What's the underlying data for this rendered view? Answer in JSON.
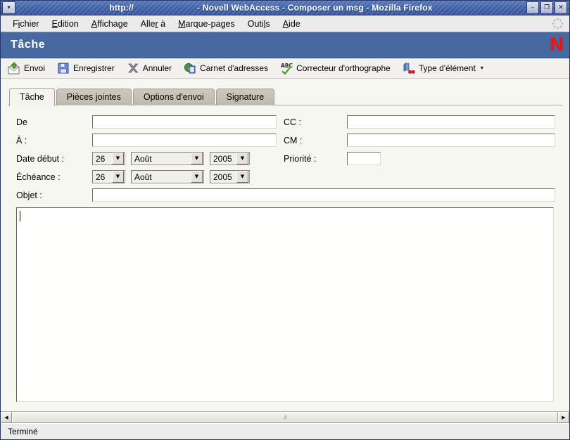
{
  "titlebar": {
    "url": "http://",
    "title": "- Novell WebAccess - Composer un msg - Mozilla Firefox",
    "sysmenu_icon": "chevron-down-icon",
    "minimize_label": "–",
    "maximize_label": "❐",
    "close_label": "✕"
  },
  "menubar": {
    "items": [
      {
        "pre": "F",
        "accel": "i",
        "post": "chier"
      },
      {
        "pre": "",
        "accel": "E",
        "post": "dition"
      },
      {
        "pre": "",
        "accel": "A",
        "post": "ffichage"
      },
      {
        "pre": "Alle",
        "accel": "r",
        "post": " à"
      },
      {
        "pre": "",
        "accel": "M",
        "post": "arque-pages"
      },
      {
        "pre": "Outi",
        "accel": "l",
        "post": "s"
      },
      {
        "pre": "",
        "accel": "A",
        "post": "ide"
      }
    ],
    "throbber_icon": "throbber-icon"
  },
  "app_header": {
    "title": "Tâche",
    "logo": "N",
    "bg_color": "#47699f",
    "logo_color": "#e01b1b"
  },
  "toolbar": {
    "items": [
      {
        "label": "Envoi",
        "icon": "send-envelope-icon",
        "dropdown": false
      },
      {
        "label": "Enregistrer",
        "icon": "save-floppy-icon",
        "dropdown": false
      },
      {
        "label": "Annuler",
        "icon": "cancel-x-icon",
        "dropdown": false
      },
      {
        "label": "Carnet d'adresses",
        "icon": "address-book-icon",
        "dropdown": false
      },
      {
        "label": "Correcteur d'orthographe",
        "icon": "spellcheck-abc-icon",
        "dropdown": false
      },
      {
        "label": "Type d'élément",
        "icon": "item-type-icon",
        "dropdown": true
      }
    ],
    "caret": "▾"
  },
  "tabs": [
    {
      "label": "Tâche",
      "active": true
    },
    {
      "label": "Pièces jointes",
      "active": false
    },
    {
      "label": "Options d'envoi",
      "active": false
    },
    {
      "label": "Signature",
      "active": false
    }
  ],
  "form": {
    "from_label": "De",
    "from_value": "",
    "to_label": "À :",
    "to_value": "",
    "cc_label": "CC :",
    "cc_value": "",
    "bc_label": "CM :",
    "bc_value": "",
    "start_date_label": "Date début :",
    "due_date_label": "Échéance :",
    "priority_label": "Priorité :",
    "priority_value": "",
    "subject_label": "Objet :",
    "subject_value": "",
    "start_day": "26",
    "start_month": "Août",
    "start_year": "2005",
    "due_day": "26",
    "due_month": "Août",
    "due_year": "2005",
    "select_arrow": "▼",
    "body_value": ""
  },
  "scrollbar": {
    "left_arrow": "◀",
    "right_arrow": "▶",
    "grip": "///"
  },
  "statusbar": {
    "text": "Terminé"
  }
}
